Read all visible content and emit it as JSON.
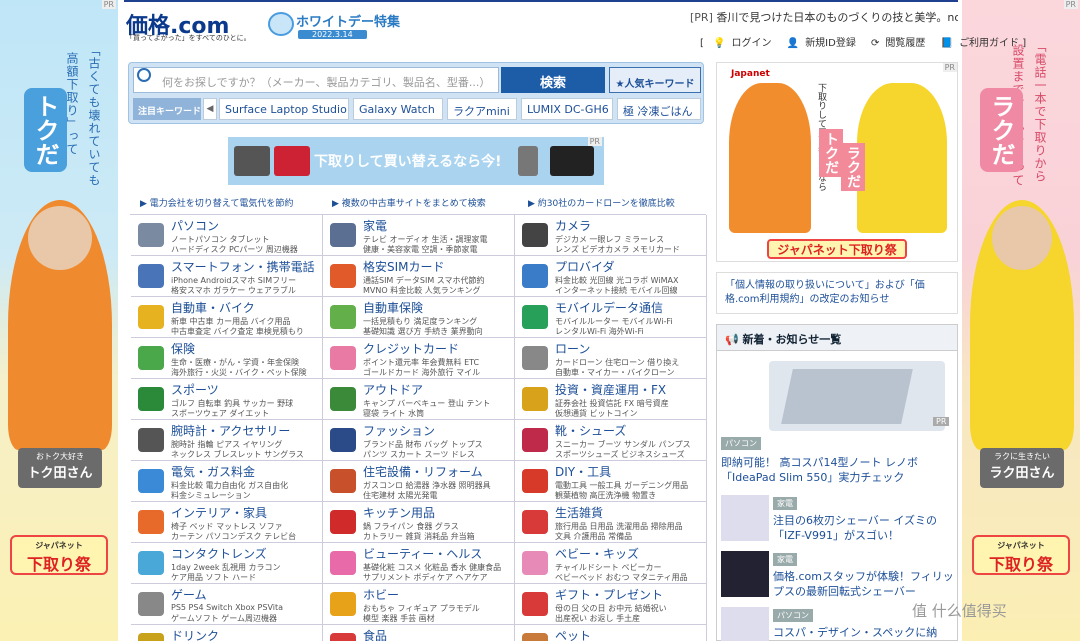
{
  "left_ad": {
    "pr": "PR",
    "vertical_text_1": "「古くても壊れていても",
    "vertical_text_2": "高額下取り」って",
    "big_text": "トクだ",
    "name_small": "おトク大好き",
    "name": "トク田さん",
    "fest_small": "ジャパネット",
    "fest": "下取り祭"
  },
  "right_ad": {
    "pr": "PR",
    "vertical_text_1": "「電話一本で下取りから",
    "vertical_text_2": "設置までおまかせ」って",
    "big_text": "ラクだ",
    "name_small": "ラクに生きたい",
    "name": "ラク田さん",
    "fest_small": "ジャパネット",
    "fest": "下取り祭"
  },
  "header": {
    "logo_main": "価格",
    "logo_com": ".com",
    "tagline": "「買ってよかった」をすべてのひとに。",
    "white_day_title": "ホワイトデー特集",
    "white_day_date": "2022.3.14",
    "pr_label": "[PR]",
    "pr_text": "香川で見つけた日本のものづくりの技と美学。nonnat...",
    "links": [
      "ログイン",
      "新規ID登録",
      "閲覧履歴",
      "ご利用ガイド"
    ]
  },
  "search": {
    "placeholder": "何をお探しですか？（メーカー、製品カテゴリ、製品名、型番...）",
    "button": "検索",
    "popular": "★人気キーワード",
    "kw_label": "注目キーワード",
    "prev": "◀",
    "keywords": [
      "Surface Laptop Studio",
      "Galaxy Watch",
      "ラクアmini",
      "LUMIX DC-GH6",
      "極 冷凍ごはん"
    ]
  },
  "banner": {
    "text": "下取りして買い替えるなら今!",
    "pr": "PR"
  },
  "promo_links": [
    "▶ 電力会社を切り替えて電気代を節約",
    "▶ 複数の中古車サイトをまとめて検索",
    "▶ 約30社のカードローンを徹底比較"
  ],
  "categories": [
    {
      "name": "パソコン",
      "s1": "ノートパソコン タブレット",
      "s2": "ハードディスク PCパーツ 周辺機器",
      "color": "#7a8aa0"
    },
    {
      "name": "家電",
      "s1": "テレビ オーディオ 生活・調理家電",
      "s2": "健康・美容家電 空調・季節家電",
      "color": "#5a6f92"
    },
    {
      "name": "カメラ",
      "s1": "デジカメ 一眼レフ ミラーレス",
      "s2": "レンズ ビデオカメラ メモリカード",
      "color": "#444"
    },
    {
      "name": "スマートフォン・携帯電話",
      "s1": "iPhone Androidスマホ SIMフリー",
      "s2": "格安スマホ ガラケー ウェアラブル",
      "color": "#4a74b8"
    },
    {
      "name": "格安SIMカード",
      "s1": "通話SIM データSIM スマホ代節約",
      "s2": "MVNO 料金比較 人気ランキング",
      "color": "#e05a2a"
    },
    {
      "name": "プロバイダ",
      "s1": "料金比較 光回線 光コラボ WiMAX",
      "s2": "インターネット接続 モバイル回線",
      "color": "#3a7cc8"
    },
    {
      "name": "自動車・バイク",
      "s1": "新車 中古車 カー用品 バイク用品",
      "s2": "中古車査定 バイク査定 車検見積もり",
      "color": "#e6b21f"
    },
    {
      "name": "自動車保険",
      "s1": "一括見積もり 満足度ランキング",
      "s2": "基礎知識 選び方 手続き 業界動向",
      "color": "#63b04a"
    },
    {
      "name": "モバイルデータ通信",
      "s1": "モバイルルーター モバイルWi-Fi",
      "s2": "レンタルWi-Fi 海外Wi-Fi",
      "color": "#27a05a"
    },
    {
      "name": "保険",
      "s1": "生命・医療・がん・学資・年金保険",
      "s2": "海外旅行・火災・バイク・ペット保険",
      "color": "#4aa84a"
    },
    {
      "name": "クレジットカード",
      "s1": "ポイント還元率 年会費無料 ETC",
      "s2": "ゴールドカード 海外旅行 マイル",
      "color": "#e87aa4"
    },
    {
      "name": "ローン",
      "s1": "カードローン 住宅ローン 借り換え",
      "s2": "自動車・マイカー・バイクローン",
      "color": "#888"
    },
    {
      "name": "スポーツ",
      "s1": "ゴルフ 自転車 釣具 サッカー 野球",
      "s2": "スポーツウェア ダイエット",
      "color": "#2a8a3a"
    },
    {
      "name": "アウトドア",
      "s1": "キャンプ バーベキュー 登山 テント",
      "s2": "寝袋 ライト 水筒",
      "color": "#3a8a3a"
    },
    {
      "name": "投資・資産運用・FX",
      "s1": "証券会社 投資信託 FX 暗号資産",
      "s2": "仮想通貨 ビットコイン",
      "color": "#d8a21a"
    },
    {
      "name": "腕時計・アクセサリー",
      "s1": "腕時計 指輪 ピアス イヤリング",
      "s2": "ネックレス ブレスレット サングラス",
      "color": "#555"
    },
    {
      "name": "ファッション",
      "s1": "ブランド品 財布 バッグ トップス",
      "s2": "パンツ スカート スーツ ドレス",
      "color": "#2a4a88"
    },
    {
      "name": "靴・シューズ",
      "s1": "スニーカー ブーツ サンダル パンプス",
      "s2": "スポーツシューズ ビジネスシューズ",
      "color": "#c02a4a"
    },
    {
      "name": "電気・ガス料金",
      "s1": "料金比較 電力自由化 ガス自由化",
      "s2": "料金シミュレーション",
      "color": "#3a8ad8"
    },
    {
      "name": "住宅設備・リフォーム",
      "s1": "ガスコンロ 給湯器 浄水器 照明器具",
      "s2": "住宅建材 太陽光発電",
      "color": "#c8502a"
    },
    {
      "name": "DIY・工具",
      "s1": "電動工具 一般工具 ガーデニング用品",
      "s2": "観葉植物 高圧洗浄機 物置き",
      "color": "#d83a2a"
    },
    {
      "name": "インテリア・家具",
      "s1": "椅子 ベッド マットレス ソファ",
      "s2": "カーテン パソコンデスク テレビ台",
      "color": "#e86a2a"
    },
    {
      "name": "キッチン用品",
      "s1": "鍋 フライパン 食器 グラス",
      "s2": "カトラリー 雑貨 消耗品 弁当箱",
      "color": "#d02a2a"
    },
    {
      "name": "生活雑貨",
      "s1": "旅行用品 日用品 洗濯用品 掃除用品",
      "s2": "文具 介護用品 常備品",
      "color": "#d83a3a"
    },
    {
      "name": "コンタクトレンズ",
      "s1": "1day 2week 乱視用 カラコン",
      "s2": "ケア用品 ソフト ハード",
      "color": "#4aa8d8"
    },
    {
      "name": "ビューティー・ヘルス",
      "s1": "基礎化粧 コスメ 化粧品 香水 健康食品",
      "s2": "サプリメント ボディケア ヘアケア",
      "color": "#e86aa8"
    },
    {
      "name": "ベビー・キッズ",
      "s1": "チャイルドシート ベビーカー",
      "s2": "ベビーベッド おむつ マタニティ用品",
      "color": "#e88ab8"
    },
    {
      "name": "ゲーム",
      "s1": "PS5 PS4 Switch Xbox PSVita",
      "s2": "ゲームソフト ゲーム周辺機器",
      "color": "#888"
    },
    {
      "name": "ホビー",
      "s1": "おもちゃ フィギュア プラモデル",
      "s2": "模型 楽器 手芸 画材",
      "color": "#e8a21a"
    },
    {
      "name": "ギフト・プレゼント",
      "s1": "母の日 父の日 お中元 結婚祝い",
      "s2": "出産祝い お返し 手土産",
      "color": "#d83a3a"
    },
    {
      "name": "ドリンク",
      "s1": "",
      "s2": "",
      "color": "#c8a21a"
    },
    {
      "name": "食品",
      "s1": "",
      "s2": "",
      "color": "#d83a3a"
    },
    {
      "name": "ペット",
      "s1": "",
      "s2": "",
      "color": "#c87a3a"
    }
  ],
  "right_col": {
    "ad_brand": "Japanet",
    "ad_v1": "下取りして買い替えるなら",
    "ad_v2": "トクだ",
    "ad_v3": "ラクだ",
    "ad_fest": "ジャパネット下取り祭",
    "notice": "「個人情報の取り扱いについて」および「価格.com利用規約」の改定のお知らせ",
    "news_title": "新着・お知らせ一覧",
    "news_pr": "PR",
    "news": [
      {
        "badge": "パソコン",
        "text": "即納可能！ 高コスパ14型ノート レノボ「IdeaPad Slim 550」実力チェック"
      },
      {
        "badge": "家電",
        "text": "注目の6枚刃シェーバー イズミの「IZF-V991」がスゴい！"
      },
      {
        "badge": "家電",
        "text": "価格.comスタッフが体験！フィリップスの最新回転式シェーバー"
      },
      {
        "badge": "パソコン",
        "text": "コスパ・デザイン・スペックに納"
      }
    ]
  },
  "watermark": "值 什么值得买"
}
